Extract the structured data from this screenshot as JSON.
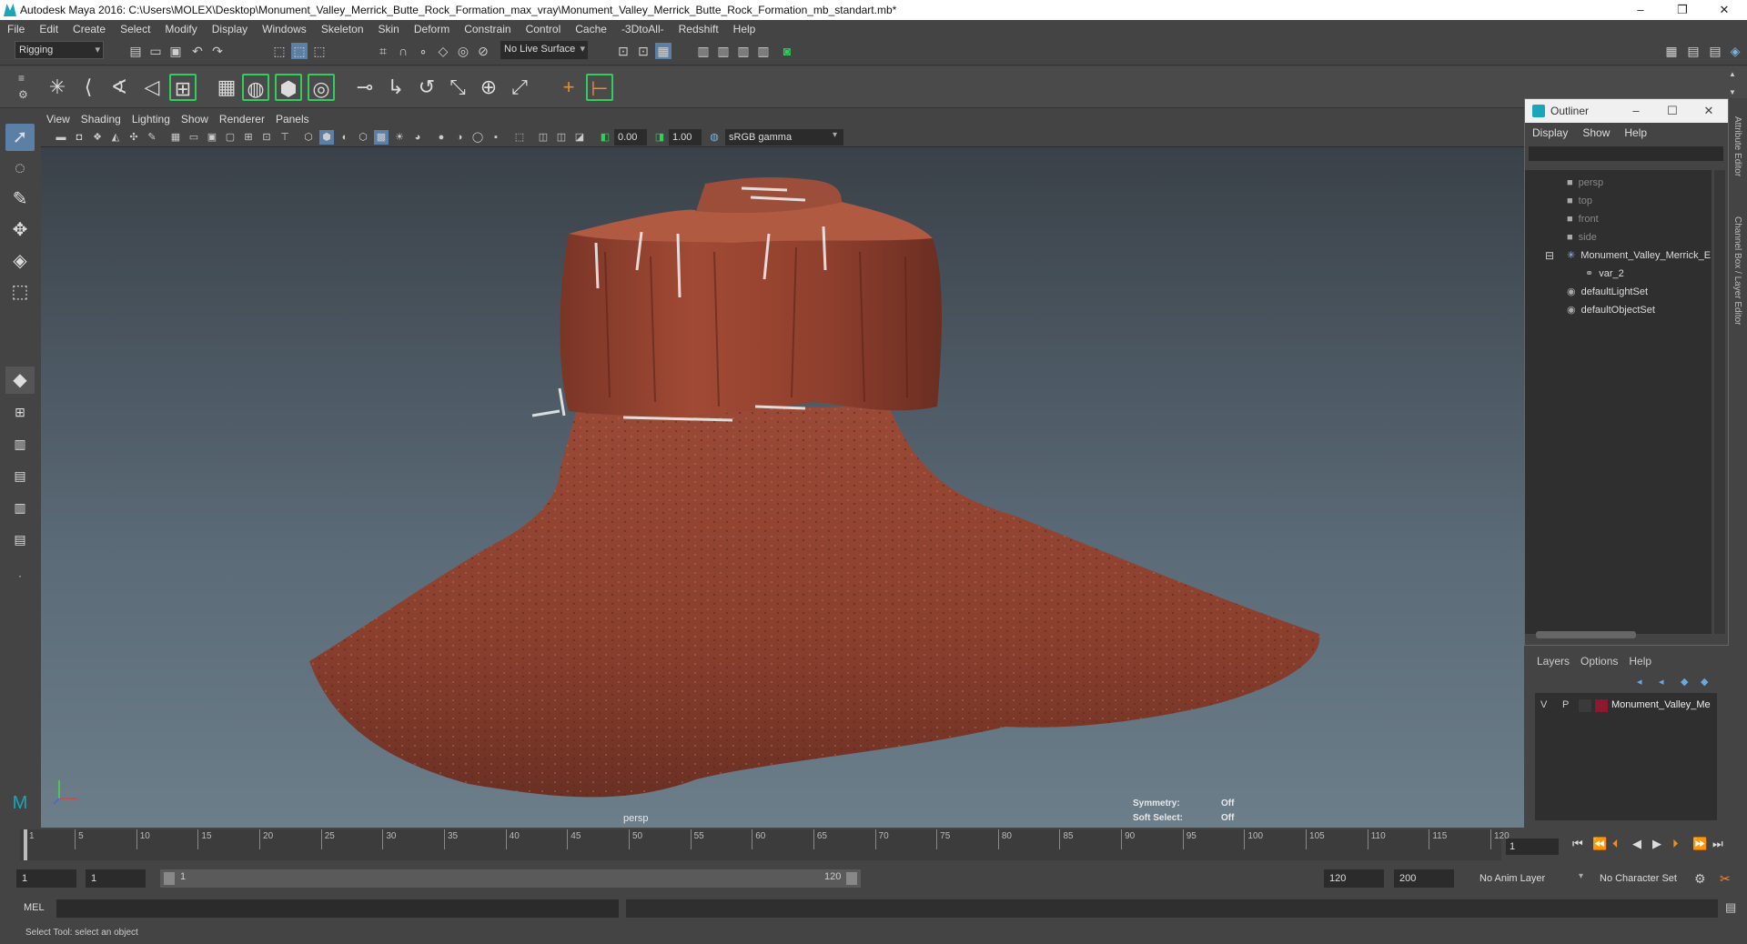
{
  "window": {
    "title": "Autodesk Maya 2016: C:\\Users\\MOLEX\\Desktop\\Monument_Valley_Merrick_Butte_Rock_Formation_max_vray\\Monument_Valley_Merrick_Butte_Rock_Formation_mb_standart.mb*",
    "controls": [
      "minimize-icon",
      "restore-icon",
      "close-icon"
    ]
  },
  "menubar": [
    "File",
    "Edit",
    "Create",
    "Select",
    "Modify",
    "Display",
    "Windows",
    "Skeleton",
    "Skin",
    "Deform",
    "Constrain",
    "Control",
    "Cache",
    "-3DtoAll-",
    "Redshift",
    "Help"
  ],
  "statusline": {
    "menuset": "Rigging",
    "live_surface": "No Live Surface"
  },
  "viewport": {
    "menu": [
      "View",
      "Shading",
      "Lighting",
      "Show",
      "Renderer",
      "Panels"
    ],
    "exposure": "0.00",
    "gamma": "1.00",
    "color_space": "sRGB gamma",
    "camera_label": "persp",
    "symmetry_label": "Symmetry:",
    "symmetry_value": "Off",
    "soft_select_label": "Soft Select:",
    "soft_select_value": "Off"
  },
  "outliner": {
    "title": "Outliner",
    "menu": [
      "Display",
      "Show",
      "Help"
    ],
    "items": [
      {
        "label": "persp",
        "icon": "camera-icon",
        "dim": true
      },
      {
        "label": "top",
        "icon": "camera-icon",
        "dim": true
      },
      {
        "label": "front",
        "icon": "camera-icon",
        "dim": true
      },
      {
        "label": "side",
        "icon": "camera-icon",
        "dim": true
      },
      {
        "label": "Monument_Valley_Merrick_E",
        "icon": "group-icon",
        "dim": false
      },
      {
        "label": "var_2",
        "icon": "mesh-icon",
        "dim": false
      },
      {
        "label": "defaultLightSet",
        "icon": "set-icon",
        "dim": false
      },
      {
        "label": "defaultObjectSet",
        "icon": "set-icon",
        "dim": false
      }
    ]
  },
  "layers": {
    "menu": [
      "Layers",
      "Options",
      "Help"
    ],
    "row": {
      "v": "V",
      "p": "P",
      "name": "Monument_Valley_Me",
      "color": "#8b1a2e"
    }
  },
  "side_tabs": [
    "Attribute Editor",
    "Channel Box / Layer Editor"
  ],
  "timeline": {
    "ticks": [
      "1",
      "5",
      "10",
      "15",
      "20",
      "25",
      "30",
      "35",
      "40",
      "45",
      "50",
      "55",
      "60",
      "65",
      "70",
      "75",
      "80",
      "85",
      "90",
      "95",
      "100",
      "105",
      "110",
      "115",
      "120"
    ],
    "current_frame": "1"
  },
  "range": {
    "start": "1",
    "playback_start": "1",
    "slider_start": "1",
    "slider_end": "120",
    "playback_end": "120",
    "end": "200",
    "anim_layer": "No Anim Layer",
    "character_set": "No Character Set"
  },
  "command": {
    "label": "MEL"
  },
  "help_line": "Select Tool: select an object"
}
